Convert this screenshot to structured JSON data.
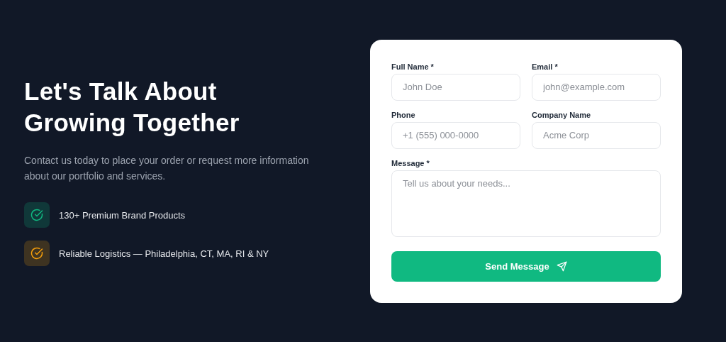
{
  "heading": {
    "lines": [
      "Let's Talk About",
      "Growing Together"
    ]
  },
  "intro": "Contact us today to place your order or request more information about our portfolio and services.",
  "features": [
    {
      "label": "130+ Premium Brand Products",
      "color": "#10b981"
    },
    {
      "label": "Reliable Logistics — Philadelphia, CT, MA, RI & NY",
      "color": "#f59e0b"
    }
  ],
  "form": {
    "fields": [
      {
        "kind": "input",
        "label": "Full Name *",
        "placeholder": "John Doe"
      },
      {
        "kind": "input",
        "label": "Email *",
        "placeholder": "john@example.com"
      },
      {
        "kind": "input",
        "label": "Phone",
        "placeholder": "+1 (555) 000-0000"
      },
      {
        "kind": "input",
        "label": "Company Name",
        "placeholder": "Acme Corp"
      },
      {
        "kind": "textarea",
        "label": "Message *",
        "placeholder": "Tell us about your needs..."
      }
    ],
    "submit": "Send Message"
  }
}
